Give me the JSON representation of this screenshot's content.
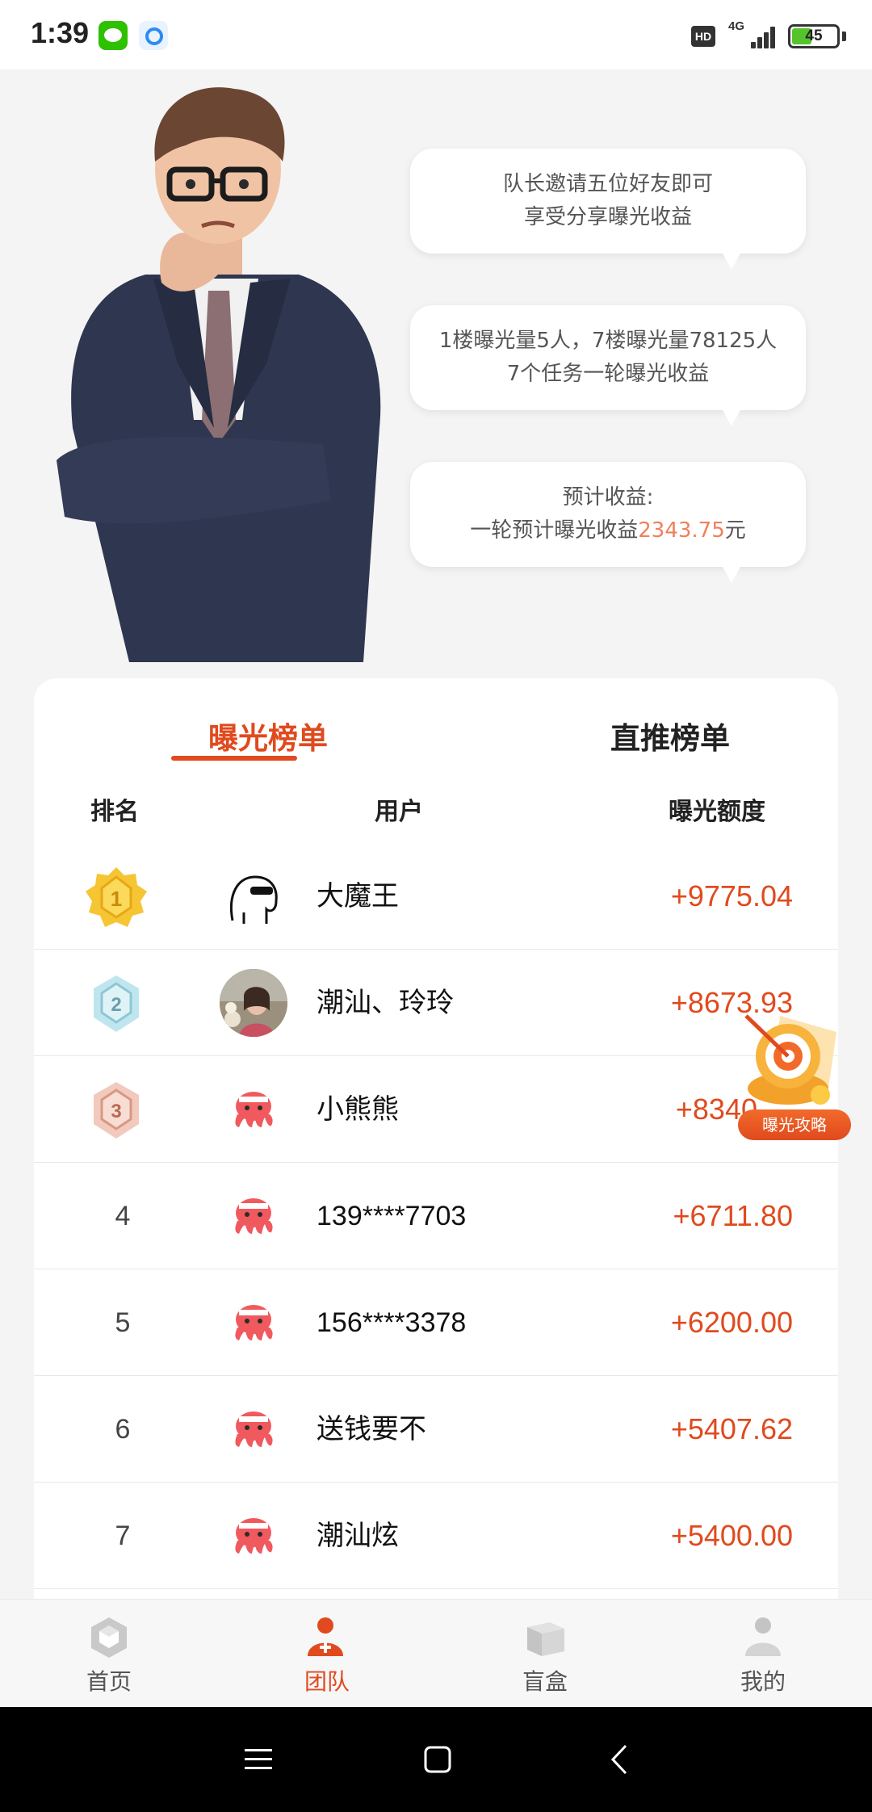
{
  "status_bar": {
    "time": "1:39",
    "network": "4G",
    "hd": "HD",
    "battery": "45",
    "battery_level": 0.45
  },
  "hero": {
    "bubbles": [
      {
        "line1": "队长邀请五位好友即可",
        "line2": "享受分享曝光收益"
      },
      {
        "line1": "1楼曝光量5人，7楼曝光量78125人",
        "line2": "7个任务一轮曝光收益"
      },
      {
        "line1": "预计收益:",
        "line2_prefix": "一轮预计曝光收益",
        "line2_value": "2343.75",
        "line2_suffix": "元"
      }
    ]
  },
  "board": {
    "tabs": [
      {
        "label": "曝光榜单"
      },
      {
        "label": "直推榜单"
      }
    ],
    "columns": {
      "rank": "排名",
      "user": "用户",
      "amount": "曝光额度"
    },
    "rows": [
      {
        "rank": "1",
        "name": "大魔王",
        "amount": "+9775.04",
        "avatar": "meme-sunglasses-icon"
      },
      {
        "rank": "2",
        "name": "潮汕、玲玲",
        "amount": "+8673.93",
        "avatar": "photo-avatar"
      },
      {
        "rank": "3",
        "name": "小熊熊",
        "amount": "+8340",
        "avatar": "octopus-icon"
      },
      {
        "rank": "4",
        "name": "139****7703",
        "amount": "+6711.80",
        "avatar": "octopus-icon"
      },
      {
        "rank": "5",
        "name": "156****3378",
        "amount": "+6200.00",
        "avatar": "octopus-icon"
      },
      {
        "rank": "6",
        "name": "送钱要不",
        "amount": "+5407.62",
        "avatar": "octopus-icon"
      },
      {
        "rank": "7",
        "name": "潮汕炫",
        "amount": "+5400.00",
        "avatar": "octopus-icon"
      }
    ]
  },
  "promo": {
    "label": "曝光攻略"
  },
  "bottom_nav": [
    {
      "label": "首页",
      "icon": "home-cube-icon"
    },
    {
      "label": "团队",
      "icon": "team-icon",
      "active": true
    },
    {
      "label": "盲盒",
      "icon": "box-icon"
    },
    {
      "label": "我的",
      "icon": "profile-icon"
    }
  ],
  "colors": {
    "accent": "#e04a1e",
    "highlight": "#f0805a",
    "background": "#f4f4f4"
  }
}
